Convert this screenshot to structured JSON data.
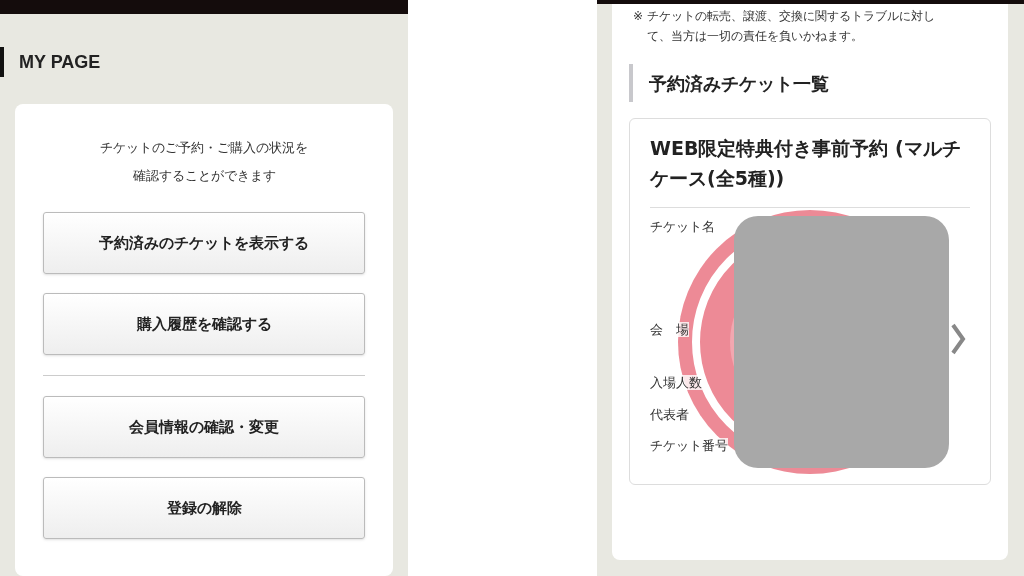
{
  "left_screen": {
    "heading": "MY PAGE",
    "intro": "チケットのご予約・ご購入の状況を確認することができます",
    "primary_buttons": [
      {
        "label": "予約済みのチケットを表示する"
      },
      {
        "label": "購入履歴を確認する"
      }
    ],
    "account_buttons": [
      {
        "label": "会員情報の確認・変更"
      },
      {
        "label": "登録の解除"
      }
    ]
  },
  "right_screen": {
    "notice": "※ チケットの転売、譲渡、交換に関するトラブルに対して、当方は一切の責任を負いかねます。",
    "section_title": "予約済みチケット一覧",
    "ticket": {
      "title": "WEB限定特典付き事前予約 (マルチケース(全5種))",
      "fields": [
        {
          "label": "チケット名"
        },
        {
          "label": "会　場"
        },
        {
          "label": "入場人数"
        },
        {
          "label": "代表者"
        },
        {
          "label": "チケット番号"
        }
      ]
    }
  }
}
